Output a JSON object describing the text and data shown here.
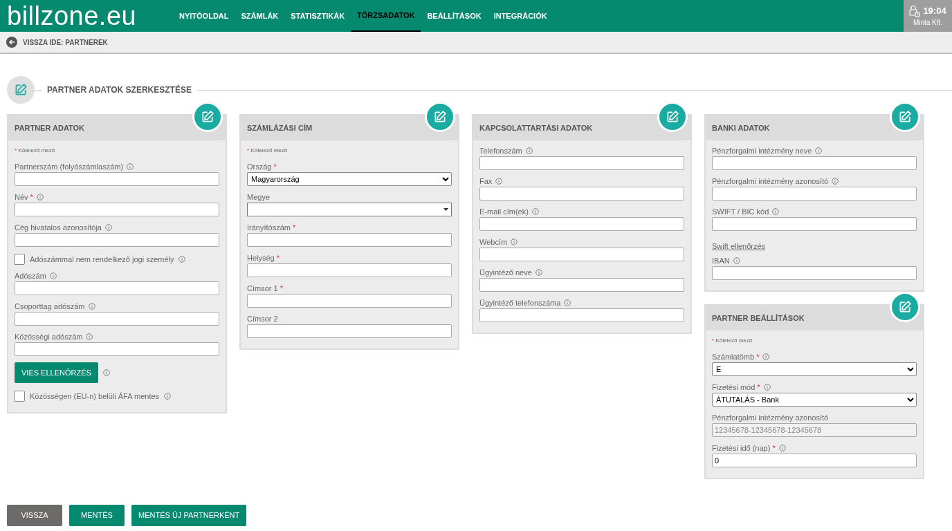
{
  "header": {
    "logo": "billzone.eu",
    "nav": [
      {
        "label": "NYITÓOLDAL",
        "selected": false
      },
      {
        "label": "SZÁMLÁK",
        "selected": false
      },
      {
        "label": "STATISZTIKÁK",
        "selected": false
      },
      {
        "label": "TÖRZSADATOK",
        "selected": true
      },
      {
        "label": "BEÁLLÍTÁSOK",
        "selected": false
      },
      {
        "label": "INTEGRÁCIÓK",
        "selected": false
      }
    ],
    "time": "19:04",
    "company": "Minta Kft."
  },
  "breadcrumb": {
    "label": "VISSZA IDE: PARTNEREK"
  },
  "page_title": "PARTNER ADATOK SZERKESZTÉSE",
  "columns": [
    {
      "cards": [
        {
          "title": "PARTNER ADATOK",
          "note": {
            "mark": "*",
            "text": "Kötelező mező"
          },
          "fields": [
            {
              "kind": "text",
              "label": "Partnerszám (folyószámlaszám)",
              "info": true
            },
            {
              "kind": "text",
              "label": "Név",
              "required_mark": "*",
              "info": true
            },
            {
              "kind": "text",
              "label": "Cég hivatalos azonosítója",
              "info": true
            },
            {
              "kind": "checkbox",
              "label": "Adószámmal nem rendelkező jogi személy",
              "checked": false,
              "info": true
            },
            {
              "kind": "text",
              "label": "Adószám",
              "info": true
            },
            {
              "kind": "text",
              "label": "Csoporttag adószám",
              "info": true
            },
            {
              "kind": "text",
              "label": "Közösségi adószám",
              "info": true
            },
            {
              "kind": "button",
              "label": "VIES ELLENŐRZÉS",
              "info": true
            },
            {
              "kind": "checkbox",
              "label": "Közösségen (EU-n) belüli ÁFA mentes",
              "checked": false,
              "info": true
            }
          ]
        }
      ]
    },
    {
      "cards": [
        {
          "title": "SZÁMLÁZÁSI CÍM",
          "note": {
            "mark": "*",
            "text": "Kötelező mező"
          },
          "fields": [
            {
              "kind": "select",
              "label": "Ország",
              "required_mark": "*",
              "info": false,
              "value": "Magyarország"
            },
            {
              "kind": "combo",
              "label": "Megye",
              "info": false
            },
            {
              "kind": "text",
              "label": "Irányítószám",
              "required_mark": "*",
              "info": false
            },
            {
              "kind": "text",
              "label": "Helység",
              "required_mark": "*",
              "info": false
            },
            {
              "kind": "text",
              "label": "Címsor 1",
              "required_mark": "*",
              "info": false
            },
            {
              "kind": "text",
              "label": "Címsor 2",
              "info": false
            }
          ]
        }
      ]
    },
    {
      "cards": [
        {
          "title": "KAPCSOLATTARTÁSI ADATOK",
          "fields": [
            {
              "kind": "text",
              "label": "Telefonszám",
              "info": true
            },
            {
              "kind": "text",
              "label": "Fax",
              "info": true
            },
            {
              "kind": "text",
              "label": "E-mail cím(ek)",
              "info": true
            },
            {
              "kind": "text",
              "label": "Webcím",
              "info": true
            },
            {
              "kind": "text",
              "label": "Ügyintéző neve",
              "info": true
            },
            {
              "kind": "text",
              "label": "Ügyintéző telefonszáma",
              "info": true
            }
          ]
        }
      ]
    },
    {
      "cards": [
        {
          "title": "BANKI ADATOK",
          "fields": [
            {
              "kind": "text",
              "label": "Pénzforgalmi intézmény neve",
              "info": true
            },
            {
              "kind": "text",
              "label": "Pénzforgalmi intézmény azonosító",
              "info": true
            },
            {
              "kind": "text",
              "label": "SWIFT / BIC kód",
              "info": true
            },
            {
              "kind": "link",
              "label": "Swift ellenőrzés"
            },
            {
              "kind": "text",
              "label": "IBAN",
              "info": true
            }
          ]
        },
        {
          "title": "PARTNER BEÁLLÍTÁSOK",
          "note": {
            "mark": "*",
            "text": "Kötelező mező"
          },
          "fields": [
            {
              "kind": "select",
              "label": "Számlatömb",
              "required_mark": "*",
              "info": true,
              "value": "E"
            },
            {
              "kind": "select",
              "label": "Fizetési mód",
              "required_mark": "*",
              "info": true,
              "value": "ÁTUTALÁS - Bank"
            },
            {
              "kind": "readonly",
              "label": "Pénzforgalmi intézmény azonosító",
              "info": false,
              "value": "12345678-12345678-12345678"
            },
            {
              "kind": "text",
              "label": "Fizetési idő (nap)",
              "required_mark": "*",
              "info": true,
              "value": "0"
            }
          ]
        }
      ]
    }
  ],
  "actions": [
    {
      "kind": "secondary",
      "label": "VISSZA"
    },
    {
      "kind": "primary",
      "label": "MENTÉS"
    },
    {
      "kind": "primary",
      "label": "MENTÉS ÚJ PARTNERKÉNT"
    }
  ]
}
